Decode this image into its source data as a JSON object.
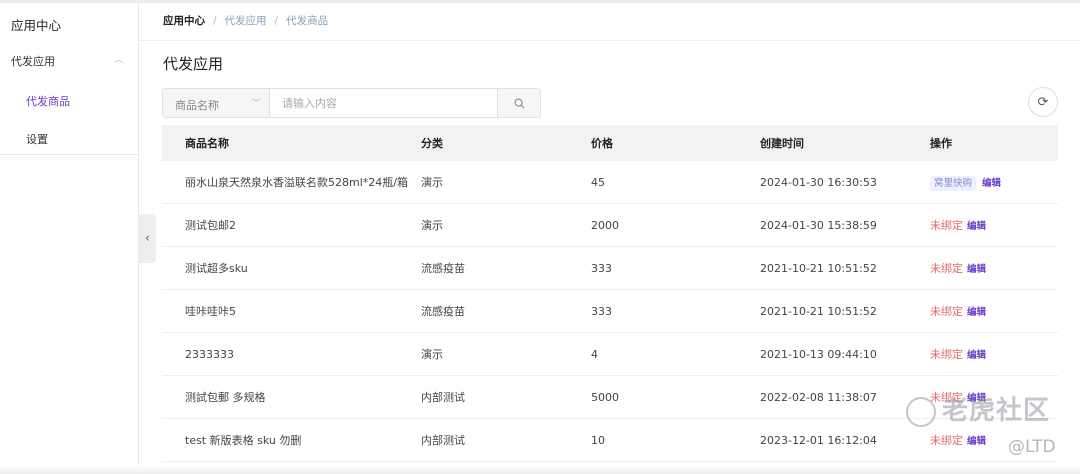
{
  "sidebar": {
    "title": "应用中心",
    "group": "代发应用",
    "items": [
      {
        "label": "代发商品",
        "active": true
      },
      {
        "label": "设置"
      }
    ]
  },
  "breadcrumb": [
    "应用中心",
    "代发应用",
    "代发商品"
  ],
  "page_title": "代发应用",
  "search": {
    "field": "商品名称",
    "placeholder": "请输入内容"
  },
  "table": {
    "headers": [
      "商品名称",
      "分类",
      "价格",
      "创建时间",
      "操作"
    ],
    "rows": [
      {
        "name": "丽水山泉天然泉水香溢联名款528ml*24瓶/箱",
        "category": "演示",
        "price": "45",
        "created": "2024-01-30 16:30:53",
        "status": "窝里快购",
        "status_type": "badge",
        "action": "编辑"
      },
      {
        "name": "测试包邮2",
        "category": "演示",
        "price": "2000",
        "created": "2024-01-30 15:38:59",
        "status": "未绑定",
        "status_type": "unbound",
        "action": "编辑"
      },
      {
        "name": "测试超多sku",
        "category": "流感疫苗",
        "price": "333",
        "created": "2021-10-21 10:51:52",
        "status": "未绑定",
        "status_type": "unbound",
        "action": "编辑"
      },
      {
        "name": "哇咔哇咔5",
        "category": "流感疫苗",
        "price": "333",
        "created": "2021-10-21 10:51:52",
        "status": "未绑定",
        "status_type": "unbound",
        "action": "编辑"
      },
      {
        "name": "2333333",
        "category": "演示",
        "price": "4",
        "created": "2021-10-13 09:44:10",
        "status": "未绑定",
        "status_type": "unbound",
        "action": "编辑"
      },
      {
        "name": "测試包郵 多规格",
        "category": "内部测试",
        "price": "5000",
        "created": "2022-02-08 11:38:07",
        "status": "未绑定",
        "status_type": "unbound",
        "action": "编辑"
      },
      {
        "name": "test 新版表格 sku 勿删",
        "category": "内部测试",
        "price": "10",
        "created": "2023-12-01 16:12:04",
        "status": "未绑定",
        "status_type": "unbound",
        "action": "编辑"
      }
    ]
  },
  "watermark": {
    "text": "老虎社区",
    "handle": "@LTD"
  }
}
